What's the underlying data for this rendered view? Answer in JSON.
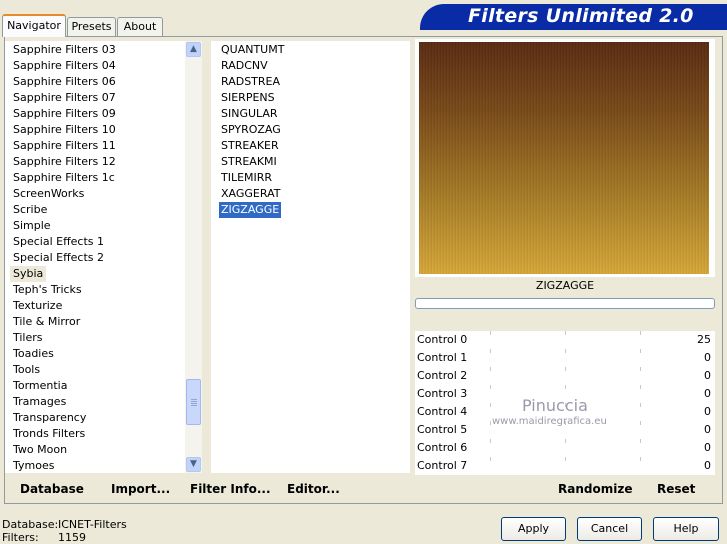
{
  "tabs": [
    "Navigator",
    "Presets",
    "About"
  ],
  "banner_title": "Filters Unlimited 2.0",
  "categories": [
    "Sapphire Filters 03",
    "Sapphire Filters 04",
    "Sapphire Filters 06",
    "Sapphire Filters 07",
    "Sapphire Filters 09",
    "Sapphire Filters 10",
    "Sapphire Filters 11",
    "Sapphire Filters 12",
    "Sapphire Filters 1c",
    "ScreenWorks",
    "Scribe",
    "Simple",
    "Special Effects 1",
    "Special Effects 2",
    "Sybia",
    "Teph's Tricks",
    "Texturize",
    "Tile & Mirror",
    "Tilers",
    "Toadies",
    "Tools",
    "Tormentia",
    "Tramages",
    "Transparency",
    "Tronds Filters",
    "Two Moon",
    "Tymoes"
  ],
  "selected_category": "Sybia",
  "filters": [
    "QUANTUMT",
    "RADCNV",
    "RADSTREA",
    "SIERPENS",
    "SINGULAR",
    "SPYROZAG",
    "STREAKER",
    "STREAKMI",
    "TILEMIRR",
    "XAGGERAT",
    "ZIGZAGGE"
  ],
  "selected_filter": "ZIGZAGGE",
  "preview_label": "ZIGZAGGE",
  "controls": [
    {
      "label": "Control 0",
      "value": "25"
    },
    {
      "label": "Control 1",
      "value": "0"
    },
    {
      "label": "Control 2",
      "value": "0"
    },
    {
      "label": "Control 3",
      "value": "0"
    },
    {
      "label": "Control 4",
      "value": "0"
    },
    {
      "label": "Control 5",
      "value": "0"
    },
    {
      "label": "Control 6",
      "value": "0"
    },
    {
      "label": "Control 7",
      "value": "0"
    }
  ],
  "bottom_buttons": {
    "database": "Database",
    "import": "Import...",
    "filter_info": "Filter Info...",
    "editor": "Editor...",
    "randomize": "Randomize",
    "reset": "Reset"
  },
  "status": {
    "database_label": "Database:",
    "database_value": "ICNET-Filters",
    "filters_label": "Filters:",
    "filters_value": "1159"
  },
  "dialog_buttons": {
    "apply": "Apply",
    "cancel": "Cancel",
    "help": "Help"
  },
  "watermark": {
    "name": "Pinuccia",
    "url": "www.maidiregrafica.eu"
  },
  "colors": {
    "accent": "#316AC5",
    "banner": "#0A2BA6",
    "tab_highlight": "#E68B2C"
  }
}
